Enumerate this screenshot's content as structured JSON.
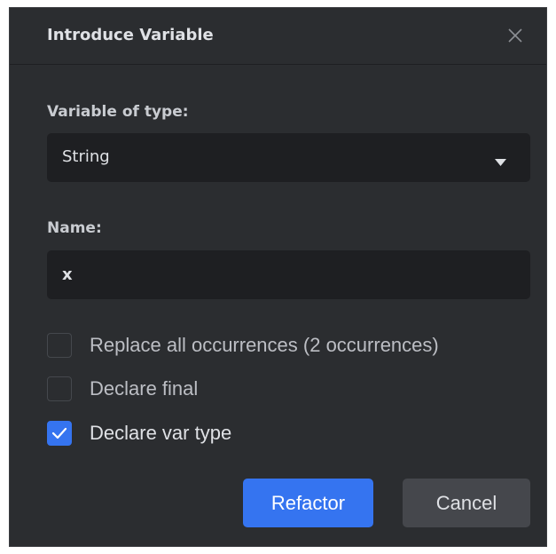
{
  "dialog": {
    "title": "Introduce Variable",
    "close_icon": "close-icon"
  },
  "type_field": {
    "label": "Variable of type:",
    "selected": "String",
    "caret_icon": "caret-down-icon"
  },
  "name_field": {
    "label": "Name:",
    "value": "x"
  },
  "options": [
    {
      "label": "Replace all occurrences (2 occurrences)",
      "checked": false
    },
    {
      "label": "Declare final",
      "checked": false
    },
    {
      "label": "Declare var type",
      "checked": true
    }
  ],
  "buttons": {
    "refactor_label": "Refactor",
    "cancel_label": "Cancel"
  },
  "colors": {
    "background": "#2b2d30",
    "input_background": "#1e1f22",
    "accent": "#3574f0",
    "secondary_button": "#45474c",
    "text": "#dfe1e5"
  }
}
